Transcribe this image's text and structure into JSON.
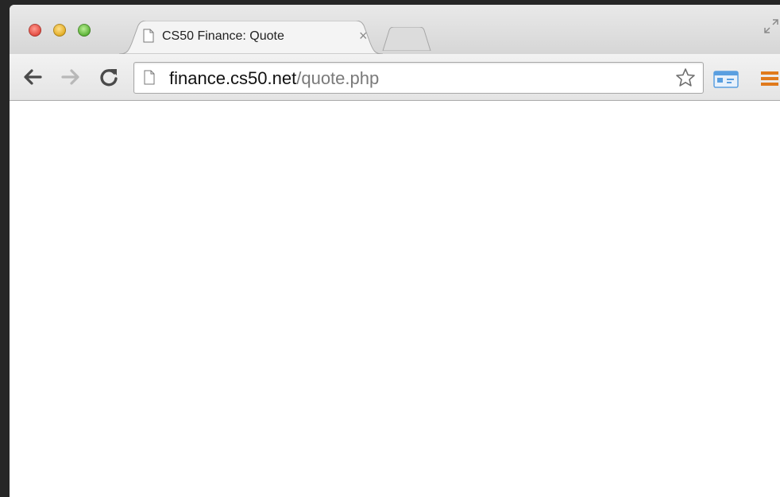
{
  "browser": {
    "tab": {
      "title": "CS50 Finance: Quote",
      "close_glyph": "×"
    },
    "address_bar": {
      "host": "finance.cs50.net",
      "path": "/quote.php"
    },
    "icons": {
      "close": "close-traffic-light",
      "minimize": "minimize-traffic-light",
      "maximize": "maximize-traffic-light",
      "page": "page-icon",
      "back": "back-arrow-icon",
      "forward": "forward-arrow-icon",
      "reload": "reload-icon",
      "bookmark": "star-icon",
      "extension": "extension-icon",
      "menu": "hamburger-menu-icon",
      "fullscreen": "fullscreen-icon"
    },
    "colors": {
      "close": "#e0443a",
      "minimize": "#e0a81c",
      "maximize": "#53ad2e",
      "menu_accent": "#e07a1c",
      "extension_accent": "#5a9fe0"
    }
  }
}
